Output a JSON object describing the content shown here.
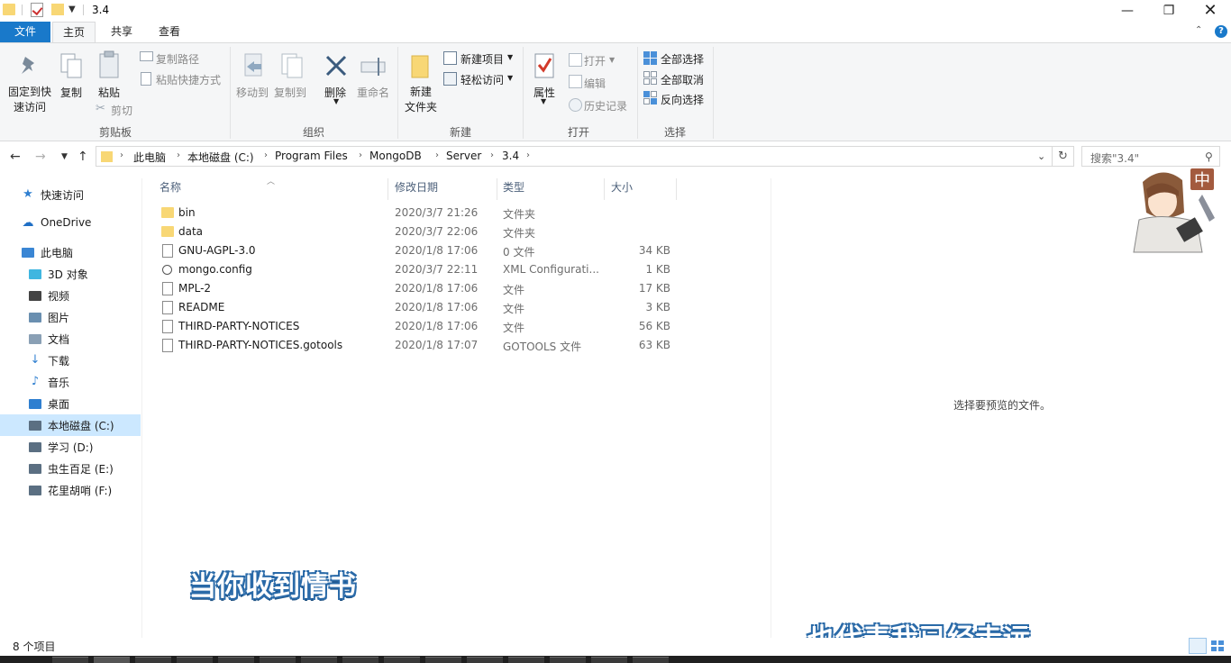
{
  "window": {
    "title": "3.4",
    "controls": [
      "minimize-icon",
      "restore-icon",
      "close-icon"
    ]
  },
  "tabs": {
    "file": "文件",
    "home": "主页",
    "share": "共享",
    "view": "查看"
  },
  "ribbon": {
    "clipboard": {
      "pin": "固定到快\n速访问",
      "pin_line1": "固定到快",
      "pin_line2": "速访问",
      "copy": "复制",
      "paste": "粘贴",
      "copy_path": "复制路径",
      "paste_shortcut": "粘贴快捷方式",
      "cut": "剪切",
      "label": "剪贴板"
    },
    "organize": {
      "move_to": "移动到",
      "copy_to": "复制到",
      "delete": "删除",
      "rename": "重命名",
      "label": "组织"
    },
    "new": {
      "new_folder_line1": "新建",
      "new_folder_line2": "文件夹",
      "new_item": "新建项目",
      "easy_access": "轻松访问",
      "label": "新建"
    },
    "open": {
      "properties": "属性",
      "open": "打开",
      "edit": "编辑",
      "history": "历史记录",
      "label": "打开"
    },
    "select": {
      "select_all": "全部选择",
      "select_none": "全部取消",
      "invert": "反向选择",
      "label": "选择"
    }
  },
  "address": {
    "crumbs": [
      "此电脑",
      "本地磁盘 (C:)",
      "Program Files",
      "MongoDB",
      "Server",
      "3.4"
    ]
  },
  "search": {
    "placeholder": "搜索\"3.4\""
  },
  "sidebar": {
    "items": [
      {
        "label": "快速访问",
        "icon": "star-icon"
      },
      {
        "label": "OneDrive",
        "icon": "cloud-icon"
      },
      {
        "label": "此电脑",
        "icon": "computer-icon"
      },
      {
        "label": "3D 对象",
        "icon": "cube-icon"
      },
      {
        "label": "视频",
        "icon": "video-icon"
      },
      {
        "label": "图片",
        "icon": "picture-icon"
      },
      {
        "label": "文档",
        "icon": "document-icon"
      },
      {
        "label": "下载",
        "icon": "download-icon"
      },
      {
        "label": "音乐",
        "icon": "music-icon"
      },
      {
        "label": "桌面",
        "icon": "desktop-icon"
      },
      {
        "label": "本地磁盘 (C:)",
        "icon": "drive-c-icon"
      },
      {
        "label": "学习 (D:)",
        "icon": "drive-icon"
      },
      {
        "label": "虫生百足 (E:)",
        "icon": "drive-icon"
      },
      {
        "label": "花里胡哨 (F:)",
        "icon": "drive-icon"
      }
    ],
    "selected": "本地磁盘 (C:)"
  },
  "list": {
    "columns": [
      "名称",
      "修改日期",
      "类型",
      "大小"
    ],
    "rows": [
      {
        "name": "bin",
        "date": "2020/3/7 21:26",
        "type": "文件夹",
        "size": "",
        "icon": "folder-icon"
      },
      {
        "name": "data",
        "date": "2020/3/7 22:06",
        "type": "文件夹",
        "size": "",
        "icon": "folder-icon"
      },
      {
        "name": "GNU-AGPL-3.0",
        "date": "2020/1/8 17:06",
        "type": "0 文件",
        "size": "34 KB",
        "icon": "file-icon"
      },
      {
        "name": "mongo.config",
        "date": "2020/3/7 22:11",
        "type": "XML Configurati...",
        "size": "1 KB",
        "icon": "config-file-icon"
      },
      {
        "name": "MPL-2",
        "date": "2020/1/8 17:06",
        "type": "文件",
        "size": "17 KB",
        "icon": "file-icon"
      },
      {
        "name": "README",
        "date": "2020/1/8 17:06",
        "type": "文件",
        "size": "3 KB",
        "icon": "file-icon"
      },
      {
        "name": "THIRD-PARTY-NOTICES",
        "date": "2020/1/8 17:06",
        "type": "文件",
        "size": "56 KB",
        "icon": "file-icon"
      },
      {
        "name": "THIRD-PARTY-NOTICES.gotools",
        "date": "2020/1/8 17:07",
        "type": "GOTOOLS 文件",
        "size": "63 KB",
        "icon": "file-icon"
      }
    ]
  },
  "preview": {
    "message": "选择要预览的文件。"
  },
  "overlay": {
    "subtitle1": "当你收到情书",
    "subtitle2": "也代表我已经走远",
    "badge": "中"
  },
  "status": {
    "count": "8 个项目"
  },
  "colors": {
    "accent": "#1979ca",
    "folder": "#f8d775",
    "selection": "#cce8ff",
    "subtitle_outline": "#2a6aa8"
  }
}
